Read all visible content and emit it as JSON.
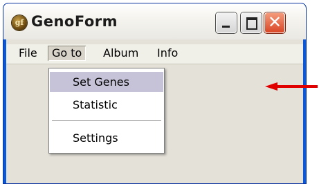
{
  "window": {
    "title": "GenoForm",
    "app_icon_glyph": "gf",
    "controls": [
      {
        "icon": "minimize-icon"
      },
      {
        "icon": "maximize-icon"
      },
      {
        "icon": "close-icon"
      }
    ]
  },
  "menubar": {
    "items": [
      "File",
      "Go to",
      "Album",
      "Info"
    ],
    "open_index": 1
  },
  "dropdown": {
    "items": [
      {
        "label": "Set Genes",
        "highlighted": true
      },
      {
        "label": "Statistic",
        "highlighted": false
      },
      {
        "separator": true
      },
      {
        "label": "Settings",
        "highlighted": false
      }
    ]
  },
  "annotation": {
    "icon": "red-arrow-icon",
    "color": "#e00000"
  },
  "colors": {
    "highlight": "#c6c3d9",
    "close_button": "#d94726",
    "titlebar": "#f5f4ef"
  }
}
